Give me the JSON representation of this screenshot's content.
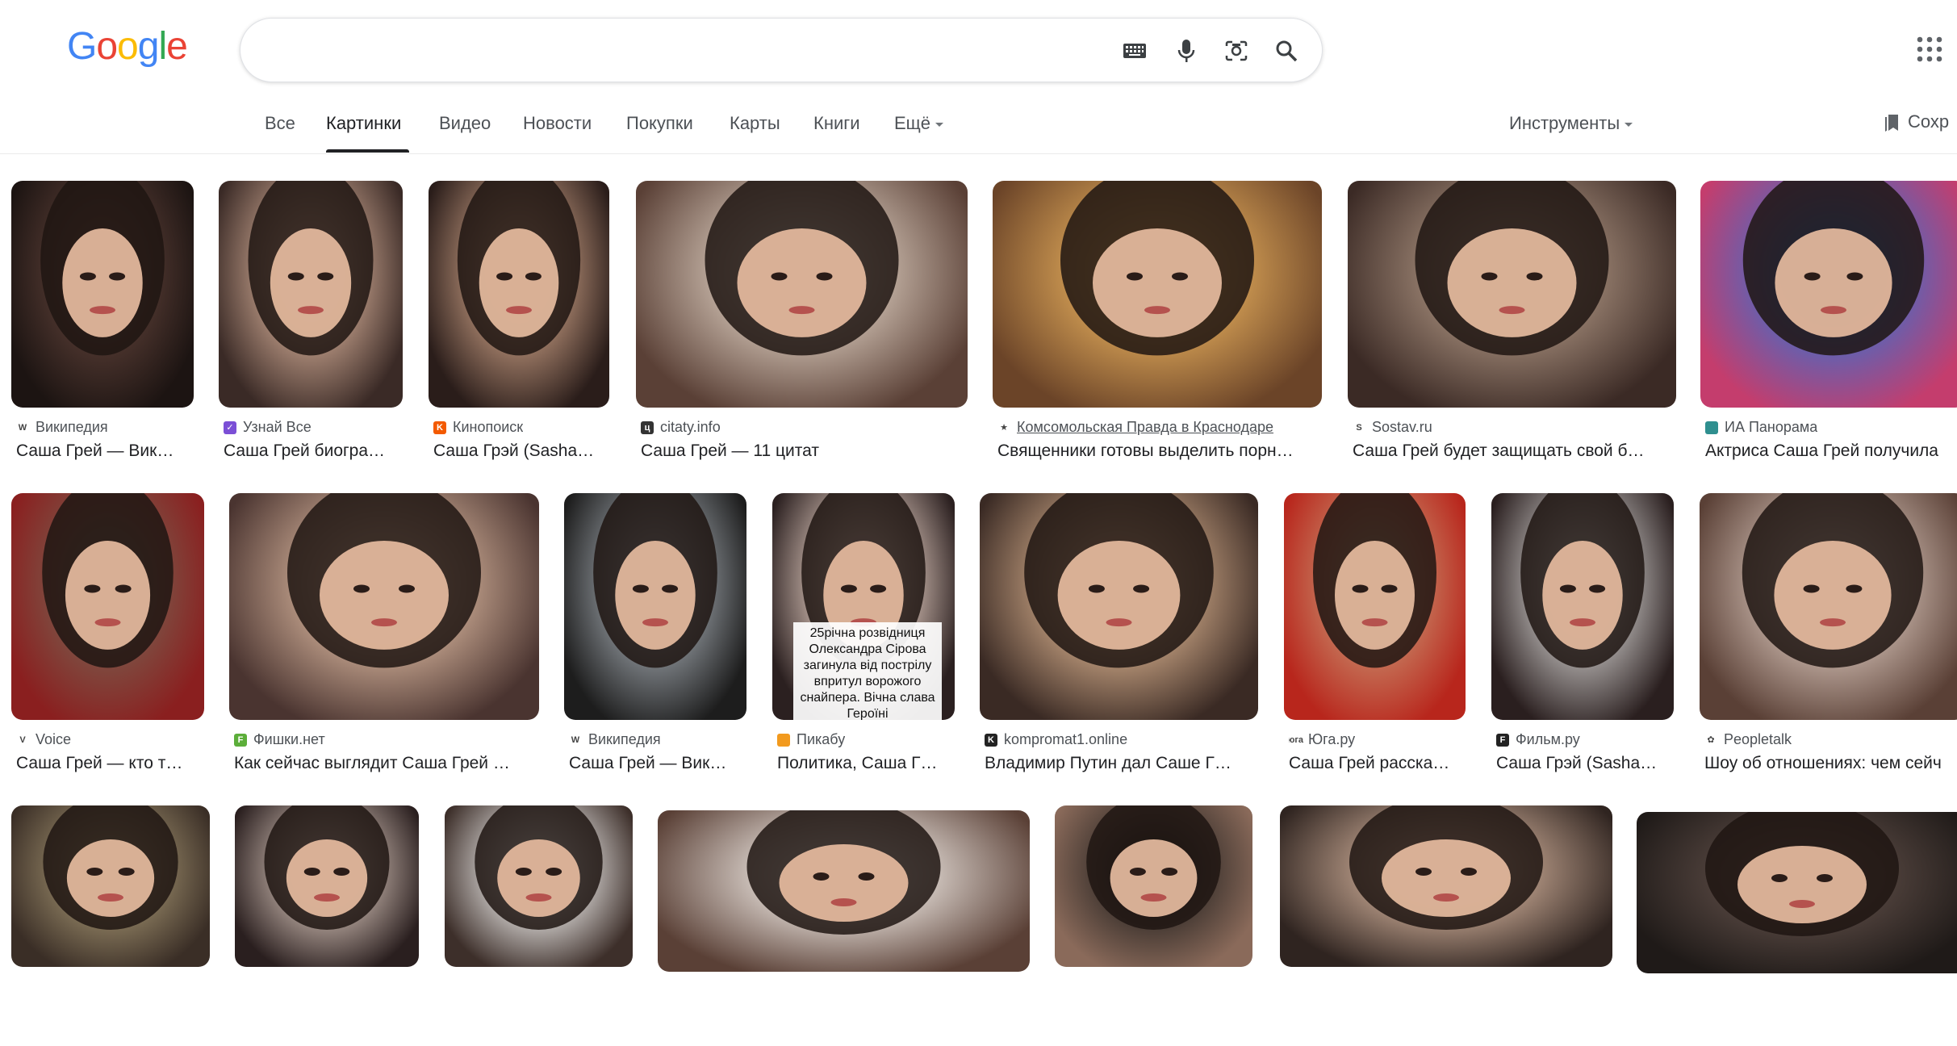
{
  "logo": {
    "letters": [
      "G",
      "o",
      "o",
      "g",
      "l",
      "e"
    ],
    "colors": [
      "#4285F4",
      "#EA4335",
      "#FBBC05",
      "#4285F4",
      "#34A853",
      "#EA4335"
    ]
  },
  "search": {
    "value": "",
    "placeholder": ""
  },
  "icons": {
    "keyboard": "keyboard-icon",
    "mic": "mic-icon",
    "lens": "lens-icon",
    "search": "search-icon",
    "apps": "apps-grid-icon",
    "bookmark": "bookmark-icon"
  },
  "tabs": [
    {
      "label": "Все",
      "active": false
    },
    {
      "label": "Картинки",
      "active": true
    },
    {
      "label": "Видео",
      "active": false
    },
    {
      "label": "Новости",
      "active": false
    },
    {
      "label": "Покупки",
      "active": false
    },
    {
      "label": "Карты",
      "active": false
    },
    {
      "label": "Книги",
      "active": false
    },
    {
      "label": "Ещё",
      "active": false
    }
  ],
  "tools_label": "Инструменты",
  "saved_label": "Сохр",
  "results": [
    {
      "source": "Википедия",
      "title": "Саша Грей — Вик…",
      "fav_color": "#ffffff",
      "fav_text": "W",
      "thumb": [
        "#5a3e36",
        "#1c1412"
      ]
    },
    {
      "source": "Узнай Все",
      "title": "Саша Грей биогра…",
      "fav_color": "#7b4fd6",
      "fav_text": "✓",
      "thumb": [
        "#cfa993",
        "#3a2a26"
      ]
    },
    {
      "source": "Кинопоиск",
      "title": "Саша Грэй (Sasha…",
      "fav_color": "#f35a00",
      "fav_text": "K",
      "thumb": [
        "#c49a80",
        "#2a1d1a"
      ]
    },
    {
      "source": "citaty.info",
      "title": "Саша Грей — 11 цитат",
      "fav_color": "#333333",
      "fav_text": "ц",
      "thumb": [
        "#d6c6b8",
        "#5a4036"
      ]
    },
    {
      "source": "Комсомольская Правда в Краснодаре",
      "title": "Священники готовы выделить порн…",
      "fav_color": "#ffffff",
      "fav_text": "★",
      "thumb": [
        "#e0a95a",
        "#6b4428"
      ]
    },
    {
      "source": "Sostav.ru",
      "title": "Саша Грей будет защищать свой б…",
      "fav_color": "#ffffff",
      "fav_text": "S",
      "thumb": [
        "#a88f7d",
        "#3b2a25"
      ]
    },
    {
      "source": "ИА Панорама",
      "title": "Актриса Саша Грей получила",
      "fav_color": "#2f8f8f",
      "fav_text": "",
      "thumb": [
        "#3f6ec9",
        "#c43d6d"
      ]
    },
    {
      "source": "Voice",
      "title": "Саша Грей — кто т…",
      "fav_color": "#ffffff",
      "fav_text": "V",
      "thumb": [
        "#7a5b4c",
        "#8a1f1f"
      ]
    },
    {
      "source": "Фишки.нет",
      "title": "Как сейчас выглядит Саша Грей …",
      "fav_color": "#5cae3a",
      "fav_text": "F",
      "thumb": [
        "#d8b59d",
        "#4a3430"
      ]
    },
    {
      "source": "Википедия",
      "title": "Саша Грей — Вик…",
      "fav_color": "#ffffff",
      "fav_text": "W",
      "thumb": [
        "#9aa0a6",
        "#1d1d1d"
      ]
    },
    {
      "source": "Пикабу",
      "title": "Политика, Саша Г…",
      "fav_color": "#f29a1e",
      "fav_text": "",
      "thumb": [
        "#e9d2c6",
        "#2b2020"
      ],
      "overlay": "25річна розвідниця Олександра Сірова загинула від пострілу впритул ворожого снайпера. Вічна слава Героїні"
    },
    {
      "source": "kompromat1.online",
      "title": "Владимир Путин дал Саше Г…",
      "fav_color": "#222222",
      "fav_text": "K",
      "thumb": [
        "#d9b18e",
        "#3a2a24"
      ]
    },
    {
      "source": "Юга.ру",
      "title": "Саша Грей расска…",
      "fav_color": "#ffffff",
      "fav_text": "юга",
      "thumb": [
        "#c98a6a",
        "#b8261c"
      ]
    },
    {
      "source": "Фильм.ру",
      "title": "Саша Грэй (Sasha…",
      "fav_color": "#222222",
      "fav_text": "F",
      "thumb": [
        "#c9c6c4",
        "#2a1f1f"
      ]
    },
    {
      "source": "Peopletalk",
      "title": "Шоу об отношениях: чем сейч",
      "fav_color": "#ffffff",
      "fav_text": "✿",
      "thumb": [
        "#d5c1b6",
        "#5a4036"
      ]
    },
    {
      "source": "",
      "title": "",
      "fav_color": "",
      "fav_text": "",
      "thumb": [
        "#9a8a6a",
        "#3a2e26"
      ]
    },
    {
      "source": "",
      "title": "",
      "fav_color": "",
      "fav_text": "",
      "thumb": [
        "#c9b7ad",
        "#2a1f1f"
      ]
    },
    {
      "source": "",
      "title": "",
      "fav_color": "",
      "fav_text": "",
      "thumb": [
        "#e8e6e4",
        "#3d2f2a"
      ]
    },
    {
      "source": "",
      "title": "",
      "fav_color": "",
      "fav_text": "",
      "thumb": [
        "#e2dad4",
        "#5a4036"
      ]
    },
    {
      "source": "",
      "title": "",
      "fav_color": "",
      "fav_text": "",
      "thumb": [
        "#2d2825",
        "#8a6a5a"
      ]
    },
    {
      "source": "",
      "title": "",
      "fav_color": "",
      "fav_text": "",
      "thumb": [
        "#c9a994",
        "#2f2420"
      ]
    },
    {
      "source": "",
      "title": "",
      "fav_color": "",
      "fav_text": "",
      "thumb": [
        "#5a4a44",
        "#1f1a18"
      ]
    }
  ]
}
